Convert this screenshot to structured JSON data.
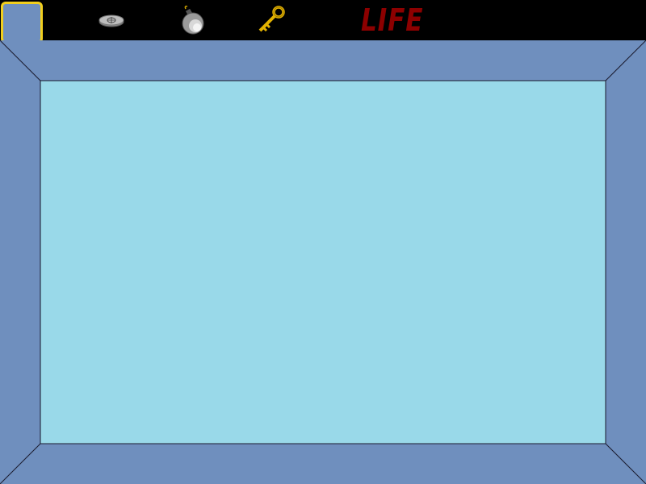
{
  "hud": {
    "selected_slot": "empty",
    "items": [
      {
        "name": "coin",
        "icon": "coin-icon"
      },
      {
        "name": "bomb",
        "icon": "bomb-icon"
      },
      {
        "name": "key",
        "icon": "key-icon"
      }
    ],
    "life_label": "LIFE"
  },
  "colors": {
    "hud_background": "#000000",
    "slot_highlight": "#f2cf1d",
    "wall": "#6f8fbe",
    "floor": "#99d9e9",
    "life_text": "#8d0000",
    "outline": "#1a1a2e"
  }
}
